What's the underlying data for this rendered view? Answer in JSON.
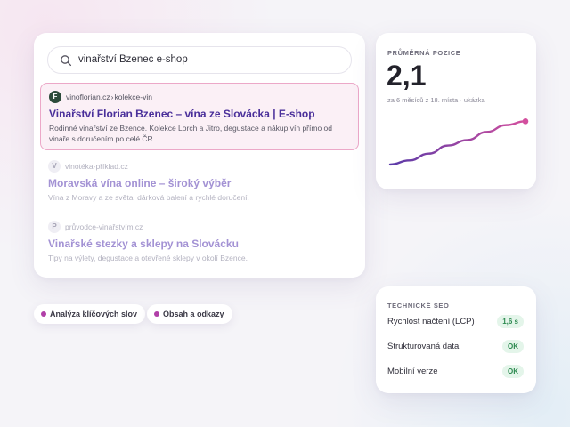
{
  "search": {
    "query": "vinařství Bzenec e-shop"
  },
  "results": [
    {
      "favicon": "F",
      "domain": "vinoflorian.cz",
      "separator": "›",
      "path": "kolekce-vin",
      "title": "Vinařství Florian Bzenec – vína ze Slovácka | E-shop",
      "desc_line1": "Rodinné vinařství ze Bzence. Kolekce Lorch a Jitro, degustace a nákup vín přímo od",
      "desc_line2": "vinaře s doručením po celé ČR."
    },
    {
      "favicon": "V",
      "domain": "vinotéka-příklad.cz",
      "title": "Moravská vína online – široký výběr",
      "desc_line1": "Vína z Moravy a ze světa, dárková balení a rychlé doručení."
    },
    {
      "favicon": "P",
      "domain": "průvodce-vinařstvím.cz",
      "title": "Vinařské stezky a sklepy na Slovácku",
      "desc_line1": "Tipy na výlety, degustace a otevřené sklepy v okolí Bzence."
    }
  ],
  "pills": [
    {
      "label": "Analýza klíčových slov"
    },
    {
      "label": "Obsah a odkazy"
    }
  ],
  "position_card": {
    "kicker": "PRŮMĚRNÁ POZICE",
    "value": "2,1",
    "subtitle": "za 6 měsíců z 18. místa · ukázka"
  },
  "chart_data": {
    "type": "line",
    "series": [
      {
        "values": [
          18,
          16.5,
          14,
          11,
          9,
          6,
          3.5,
          2.1
        ]
      }
    ],
    "ylim": [
      1,
      20
    ],
    "y_inverted": true,
    "colors": {
      "start": "#5a3aa8",
      "end": "#d34f9e"
    }
  },
  "tech_card": {
    "kicker": "TECHNICKÉ SEO",
    "rows": [
      {
        "label": "Rychlost načtení (LCP)",
        "badge": "1,6 s"
      },
      {
        "label": "Strukturovaná data",
        "badge": "OK"
      },
      {
        "label": "Mobilní verze",
        "badge": "OK"
      }
    ]
  }
}
